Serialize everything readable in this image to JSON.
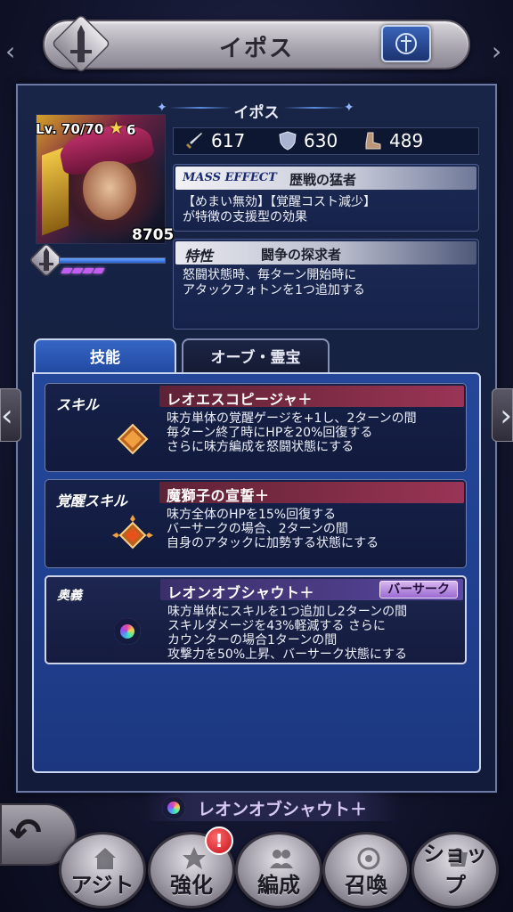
{
  "header": {
    "title": "イポス",
    "emblem_icon": "sword-icon",
    "card_icon": "card-icon"
  },
  "character": {
    "name": "イポス",
    "level": "Lv. 70/70",
    "stars": "6",
    "power": "8705",
    "exp_fraction": 1.0,
    "ability_dots": 4
  },
  "stats": {
    "attack": "617",
    "defense": "630",
    "speed": "489"
  },
  "mass_effect": {
    "tag": "MASS EFFECT",
    "title": "歴戦の猛者",
    "desc_line1": "【めまい無効】【覚醒コスト減少】",
    "desc_line2": "が特徴の支援型の効果"
  },
  "trait": {
    "tag": "特性",
    "title": "闘争の探求者",
    "desc_line1": "怒闘状態時、毎ターン開始時に",
    "desc_line2": "アタックフォトンを1つ追加する"
  },
  "tabs": [
    {
      "label": "技能",
      "active": true
    },
    {
      "label": "オーブ・霊宝",
      "active": false
    }
  ],
  "skills": [
    {
      "type": "スキル",
      "name": "レオエスコピージャ＋",
      "lines": [
        "味方単体の覚醒ゲージを+1し、2ターンの間",
        "毎ターン終了時にHPを20%回復する",
        "さらに味方編成を怒闘状態にする"
      ]
    },
    {
      "type": "覚醒スキル",
      "name": "魔獅子の宣誓＋",
      "lines": [
        "味方全体のHPを15%回復する",
        "バーサークの場合、2ターンの間",
        "自身のアタックに加勢する状態にする"
      ]
    },
    {
      "type": "奥義",
      "name": "レオンオブシャウト＋",
      "badge": "バーサーク",
      "lines": [
        "味方単体にスキルを1つ追加し2ターンの間",
        "スキルダメージを43%軽減する さらに",
        "カウンターの場合1ターンの間",
        "攻撃力を50%上昇、バーサーク状態にする"
      ]
    }
  ],
  "ougi_label": "レオンオブシャウト＋",
  "bottom_nav": [
    {
      "label": "アジト",
      "icon": "base-icon"
    },
    {
      "label": "強化",
      "icon": "enhance-icon",
      "alert": "!"
    },
    {
      "label": "編成",
      "icon": "party-icon"
    },
    {
      "label": "召喚",
      "icon": "summon-icon"
    },
    {
      "label": "ショップ",
      "icon": "shop-icon"
    }
  ]
}
